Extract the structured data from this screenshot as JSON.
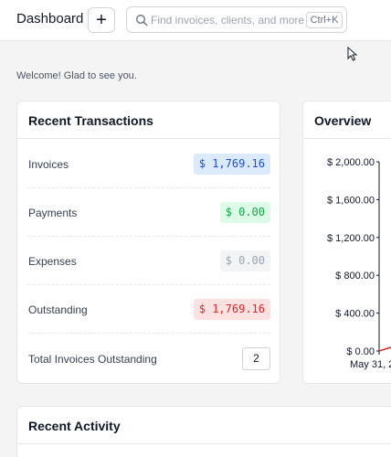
{
  "header": {
    "title": "Dashboard",
    "add_label": "+",
    "search_placeholder": "Find invoices, clients, and more",
    "search_shortcut": "Ctrl+K"
  },
  "welcome": "Welcome! Glad to see you.",
  "recent_transactions": {
    "title": "Recent Transactions",
    "rows": [
      {
        "label": "Invoices",
        "value": "$ 1,769.16",
        "color": "#1d4ed8"
      },
      {
        "label": "Payments",
        "value": "$ 0.00",
        "color": "#16a34a"
      },
      {
        "label": "Expenses",
        "value": "$ 0.00",
        "color": "#9ca3af"
      },
      {
        "label": "Outstanding",
        "value": "$ 1,769.16",
        "color": "#dc2626"
      }
    ],
    "total_label": "Total Invoices Outstanding",
    "total_count": "2"
  },
  "overview": {
    "title": "Overview"
  },
  "chart_data": {
    "type": "line",
    "title": "",
    "xlabel": "",
    "ylabel": "",
    "ylim": [
      0,
      2000
    ],
    "yticks": [
      "$ 0.00",
      "$ 400.00",
      "$ 800.00",
      "$ 1,200.00",
      "$ 1,600.00",
      "$ 2,000.00"
    ],
    "ytick_values": [
      0,
      400,
      800,
      1200,
      1600,
      2000
    ],
    "x_first_label": "May 31, 2",
    "series_colors": [
      "#dc2626"
    ]
  },
  "recent_activity": {
    "title": "Recent Activity"
  }
}
